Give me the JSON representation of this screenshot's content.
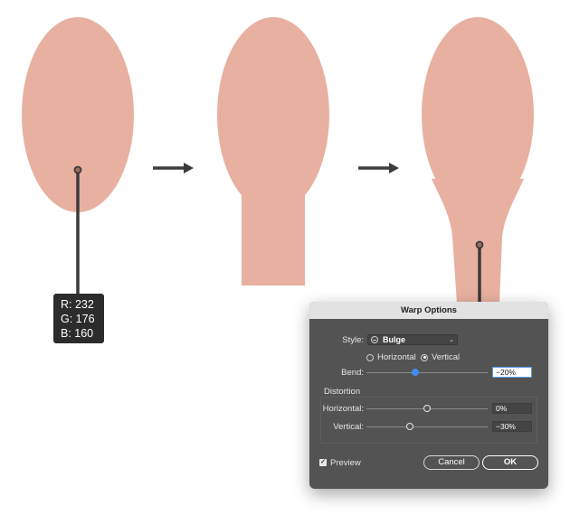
{
  "illustration": {
    "shape_color": "#e8b0a0",
    "arrow_color": "#3c3c3c",
    "color_readout": [
      "R: 232",
      "G: 176",
      "B: 160"
    ]
  },
  "warp_dialog": {
    "title": "Warp Options",
    "style_label": "Style:",
    "style_value": "Bulge",
    "orientation": {
      "horizontal_label": "Horizontal",
      "vertical_label": "Vertical",
      "selected": "Vertical"
    },
    "bend": {
      "label": "Bend:",
      "value": "−20%",
      "percent": -20
    },
    "distortion": {
      "group_label": "Distortion",
      "horizontal": {
        "label": "Horizontal:",
        "value": "0%",
        "percent": 0
      },
      "vertical": {
        "label": "Vertical:",
        "value": "−30%",
        "percent": -30
      }
    },
    "preview": {
      "label": "Preview",
      "checked": true
    },
    "cancel_label": "Cancel",
    "ok_label": "OK",
    "accent_color": "#3f8ef0"
  }
}
